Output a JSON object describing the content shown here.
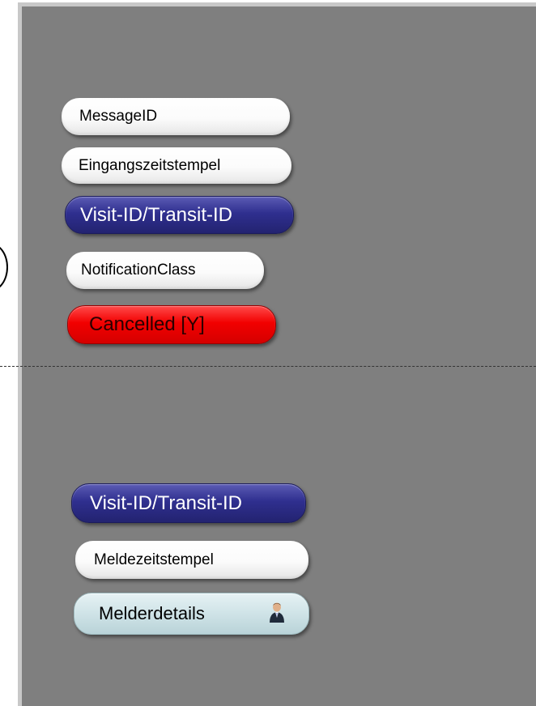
{
  "upper_section": {
    "fields": [
      {
        "label": "MessageID",
        "style": "white"
      },
      {
        "label": "Eingangszeitstempel",
        "style": "white"
      },
      {
        "label": "Visit-ID/Transit-ID",
        "style": "blue"
      },
      {
        "label": "NotificationClass",
        "style": "white"
      },
      {
        "label": "Cancelled [Y]",
        "style": "red"
      }
    ]
  },
  "lower_section": {
    "fields": [
      {
        "label": "Visit-ID/Transit-ID",
        "style": "blue"
      },
      {
        "label": "Meldezeitstempel",
        "style": "white"
      },
      {
        "label": "Melderdetails",
        "style": "light",
        "icon": "person-icon"
      }
    ]
  },
  "colors": {
    "panel": "#7f7f7f",
    "blue_pill": "#2f2f8f",
    "red_pill": "#f20000",
    "light_pill": "#cfe3e7"
  }
}
